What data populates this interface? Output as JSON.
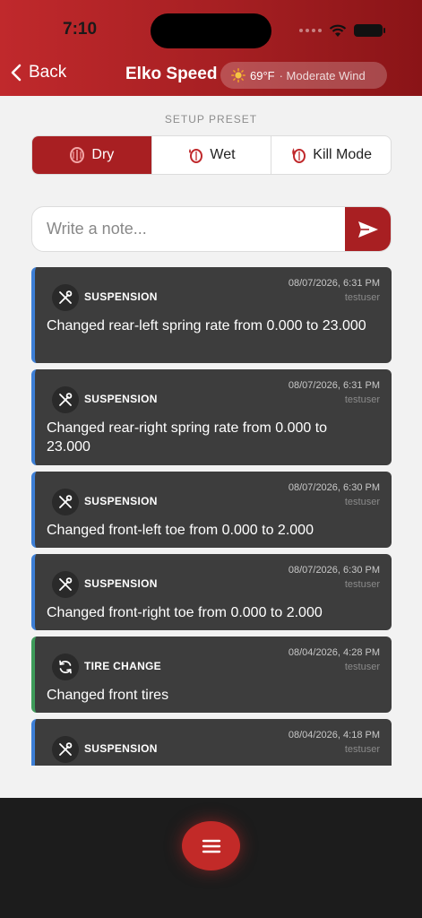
{
  "status_bar": {
    "time": "7:10"
  },
  "header": {
    "back_label": "Back",
    "title": "Elko Speed",
    "weather": {
      "temp": "69°F",
      "condition": "· Moderate Wind",
      "icon": "sun-icon"
    }
  },
  "preset": {
    "label": "SETUP PRESET",
    "options": [
      {
        "label": "Dry",
        "icon": "tire-icon",
        "active": true
      },
      {
        "label": "Wet",
        "icon": "rain-tire-icon",
        "active": false
      },
      {
        "label": "Kill Mode",
        "icon": "fire-tire-icon",
        "active": false
      }
    ]
  },
  "note": {
    "placeholder": "Write a note...",
    "value": ""
  },
  "logs": [
    {
      "category": "SUSPENSION",
      "date": "08/07/2026, 6:31 PM",
      "user": "testuser",
      "text": "Changed rear-left spring rate from 0.000 to 23.000",
      "icon": "tools-icon"
    },
    {
      "category": "SUSPENSION",
      "date": "08/07/2026, 6:31 PM",
      "user": "testuser",
      "text": "Changed rear-right spring rate from 0.000 to 23.000",
      "icon": "tools-icon"
    },
    {
      "category": "SUSPENSION",
      "date": "08/07/2026, 6:30 PM",
      "user": "testuser",
      "text": "Changed front-left toe from 0.000 to 2.000",
      "icon": "tools-icon"
    },
    {
      "category": "SUSPENSION",
      "date": "08/07/2026, 6:30 PM",
      "user": "testuser",
      "text": "Changed front-right toe from 0.000 to 2.000",
      "icon": "tools-icon"
    },
    {
      "category": "TIRE CHANGE",
      "date": "08/04/2026, 4:28 PM",
      "user": "testuser",
      "text": "Changed front tires",
      "icon": "refresh-icon"
    },
    {
      "category": "SUSPENSION",
      "date": "08/04/2026, 4:18 PM",
      "user": "testuser",
      "text": "",
      "icon": "tools-icon"
    }
  ],
  "colors": {
    "accent": "#a81f22",
    "suspension_bar": "#3d7fd6",
    "tire_bar": "#3e9b5a",
    "card_bg": "#3d3d3d"
  }
}
